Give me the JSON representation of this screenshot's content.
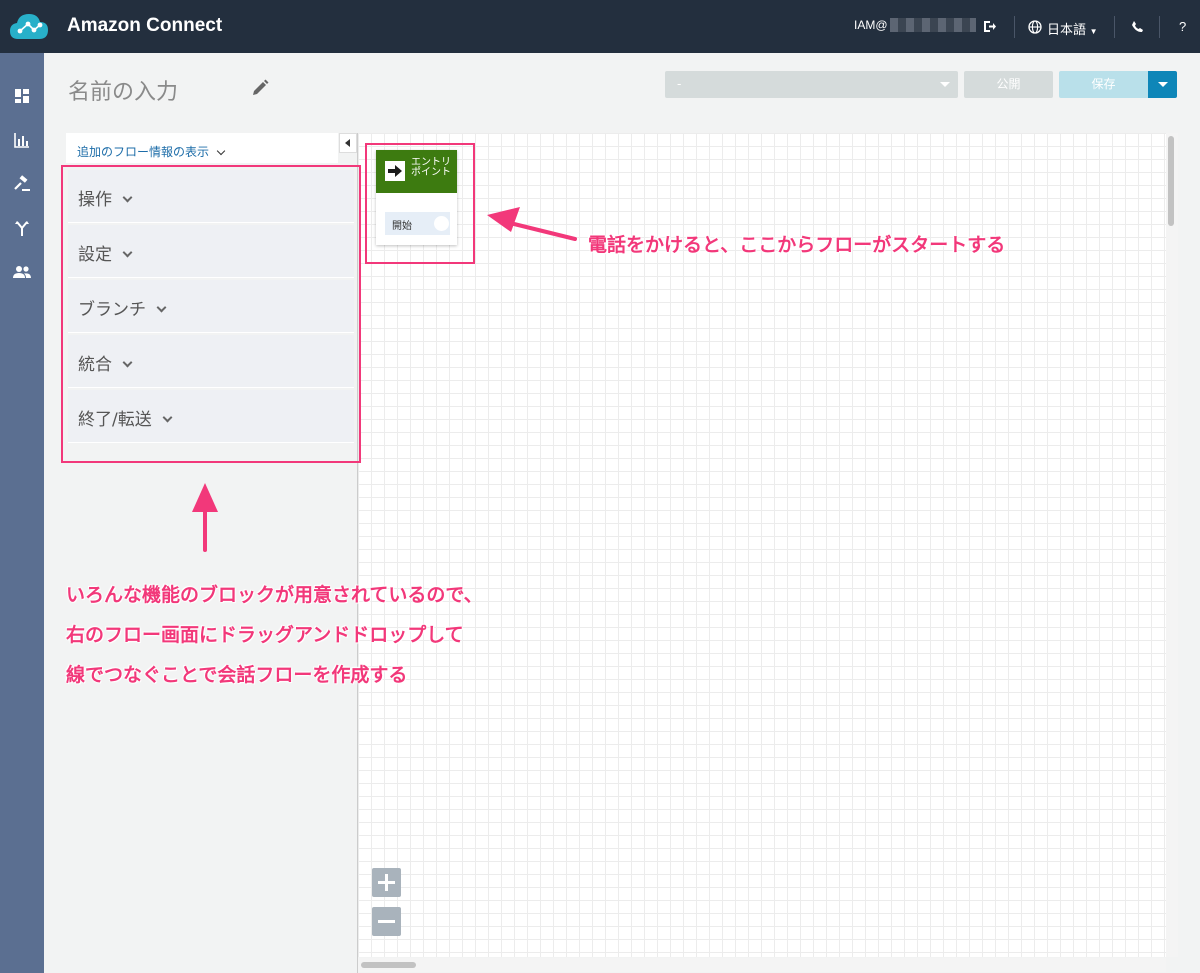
{
  "app": {
    "title": "Amazon Connect"
  },
  "topbar": {
    "user": "IAM@",
    "language": "日本語",
    "help": "?"
  },
  "header": {
    "flow_name": "名前の入力",
    "version_select": "-",
    "publish_label": "公開",
    "save_label": "保存"
  },
  "panel": {
    "more_info_label": "追加のフロー情報の表示",
    "categories": [
      {
        "label": "操作"
      },
      {
        "label": "設定"
      },
      {
        "label": "ブランチ"
      },
      {
        "label": "統合"
      },
      {
        "label": "終了/転送"
      }
    ]
  },
  "entry_block": {
    "title": "エントリポイント",
    "start_label": "開始"
  },
  "annotations": {
    "entry_note": "電話をかけると、ここからフローがスタートする",
    "blocks_note_1": "いろんな機能のブロックが用意されているので、",
    "blocks_note_2": "右のフロー画面にドラッグアンドドロップして",
    "blocks_note_3": "線でつなぐことで会話フローを作成する"
  },
  "colors": {
    "topbar": "#232f3e",
    "rail": "#5b6f91",
    "entry_header": "#3d7b10",
    "annotation": "#f2387a",
    "save_dropdown": "#0e86b8"
  }
}
